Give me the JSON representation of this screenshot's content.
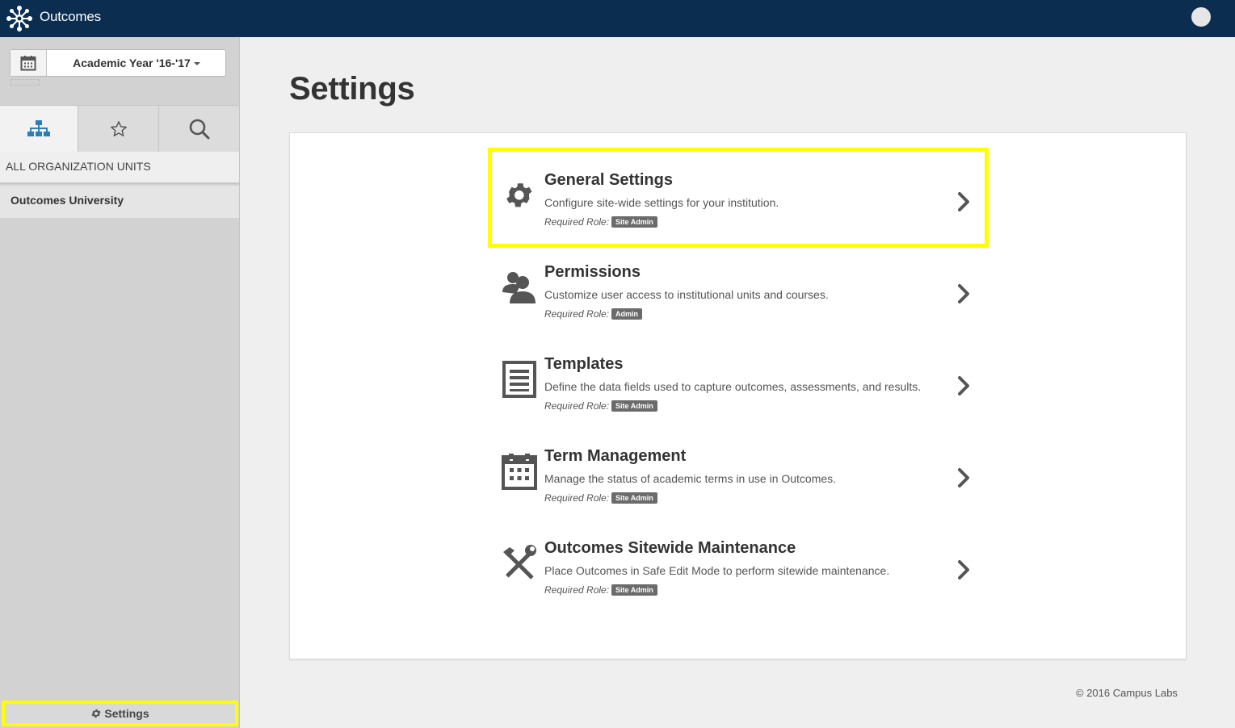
{
  "app": {
    "title": "Outcomes"
  },
  "sidebar": {
    "year_label": "Academic Year '16-'17",
    "org_header": "ALL ORGANIZATION UNITS",
    "org_item": "Outcomes University",
    "footer_label": "Settings",
    "tabs": [
      {
        "icon": "org-chart-icon",
        "active": true
      },
      {
        "icon": "star-icon",
        "active": false
      },
      {
        "icon": "search-icon",
        "active": false
      }
    ]
  },
  "main": {
    "title": "Settings",
    "role_prefix": "Required Role:",
    "items": [
      {
        "icon": "gear-icon",
        "title": "General Settings",
        "desc": "Configure site-wide settings for your institution.",
        "role": "Site Admin",
        "highlighted": true
      },
      {
        "icon": "users-icon",
        "title": "Permissions",
        "desc": "Customize user access to institutional units and courses.",
        "role": "Admin",
        "highlighted": false
      },
      {
        "icon": "template-icon",
        "title": "Templates",
        "desc": "Define the data fields used to capture outcomes, assessments, and results.",
        "role": "Site Admin",
        "highlighted": false
      },
      {
        "icon": "calendar-icon",
        "title": "Term Management",
        "desc": "Manage the status of academic terms in use in Outcomes.",
        "role": "Site Admin",
        "highlighted": false
      },
      {
        "icon": "tools-icon",
        "title": "Outcomes Sitewide Maintenance",
        "desc": "Place Outcomes in Safe Edit Mode to perform sitewide maintenance.",
        "role": "Site Admin",
        "highlighted": false
      }
    ]
  },
  "footer": {
    "copyright": "© 2016 Campus Labs"
  },
  "colors": {
    "topbar": "#0b2d4f",
    "highlight": "#ffff00",
    "accent": "#2a7fb8",
    "badge": "#6b6b6b"
  }
}
